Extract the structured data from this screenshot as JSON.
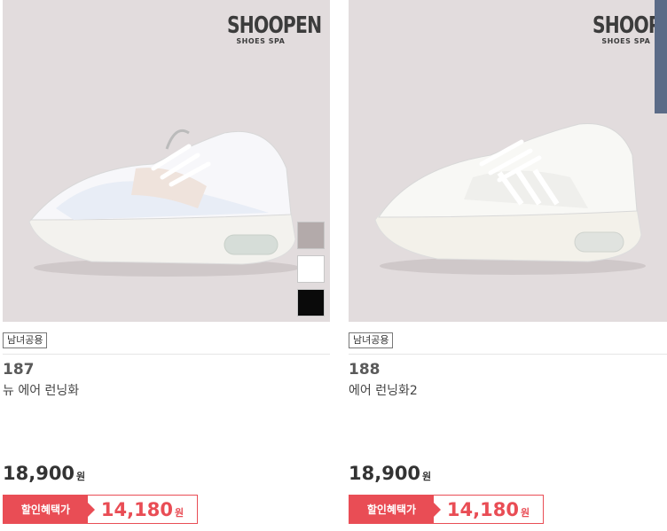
{
  "products": [
    {
      "brand": "SHOOPEN",
      "brand_sub": "SHOES SPA",
      "badge": "남녀공용",
      "number": "187",
      "name": "뉴 에어 런닝화",
      "price": "18,900",
      "price_unit": "원",
      "sale_label": "할인혜택가",
      "sale_price": "14,180",
      "sale_unit": "원",
      "swatch_colors": [
        "#b3aaaa",
        "#ffffff",
        "#0a0a0a"
      ]
    },
    {
      "brand": "SHOOPEN",
      "brand_sub": "SHOES SPA",
      "badge": "남녀공용",
      "number": "188",
      "name": "에어 런닝화2",
      "price": "18,900",
      "price_unit": "원",
      "sale_label": "할인혜택가",
      "sale_price": "14,180",
      "sale_unit": "원",
      "swatch_colors": [
        "#ffffff",
        "#0a0a0a"
      ]
    }
  ],
  "colors": {
    "image_bg": "#e2dcdd",
    "sale_accent": "#e94d55"
  }
}
